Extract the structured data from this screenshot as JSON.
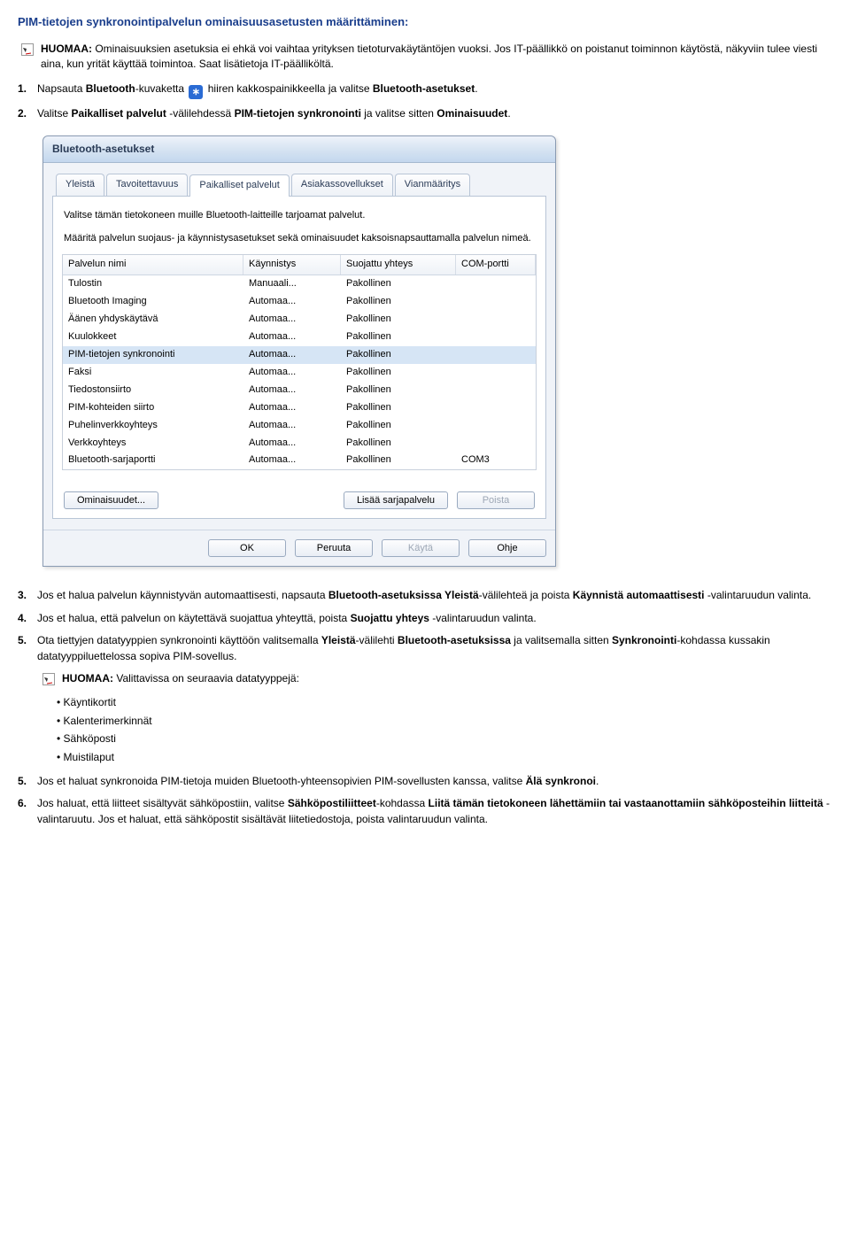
{
  "heading": "PIM-tietojen synkronointipalvelun ominaisuusasetusten määrittäminen:",
  "note1": {
    "label": "HUOMAA:",
    "text": " Ominaisuuksien asetuksia ei ehkä voi vaihtaa yrityksen tietoturvakäytäntöjen vuoksi. Jos IT-päällikkö on poistanut toiminnon käytöstä, näkyviin tulee viesti aina, kun yrität käyttää toimintoa. Saat lisätietoja IT-päälliköltä."
  },
  "step1": {
    "num": "1.",
    "a": "Napsauta ",
    "b1": "Bluetooth",
    "b": "-kuvaketta ",
    "c": " hiiren kakkospainikkeella ja valitse ",
    "b2": "Bluetooth-asetukset",
    "d": "."
  },
  "step2": {
    "num": "2.",
    "a": "Valitse ",
    "b1": "Paikalliset palvelut",
    "b": " -välilehdessä ",
    "b2": "PIM-tietojen synkronointi",
    "c": " ja valitse sitten ",
    "b3": "Ominaisuudet",
    "d": "."
  },
  "dialog": {
    "title": "Bluetooth-asetukset",
    "tabs": [
      "Yleistä",
      "Tavoitettavuus",
      "Paikalliset palvelut",
      "Asiakassovellukset",
      "Vianmääritys"
    ],
    "panel_text1": "Valitse tämän tietokoneen muille Bluetooth-laitteille tarjoamat palvelut.",
    "panel_text2": "Määritä palvelun suojaus- ja käynnistysasetukset sekä ominaisuudet kaksoisnapsauttamalla palvelun nimeä.",
    "headers": [
      "Palvelun nimi",
      "Käynnistys",
      "Suojattu yhteys",
      "COM-portti"
    ],
    "rows": [
      {
        "n": "Tulostin",
        "k": "Manuaali...",
        "s": "Pakollinen",
        "c": ""
      },
      {
        "n": "Bluetooth Imaging",
        "k": "Automaa...",
        "s": "Pakollinen",
        "c": ""
      },
      {
        "n": "Äänen yhdyskäytävä",
        "k": "Automaa...",
        "s": "Pakollinen",
        "c": ""
      },
      {
        "n": "Kuulokkeet",
        "k": "Automaa...",
        "s": "Pakollinen",
        "c": ""
      },
      {
        "n": "PIM-tietojen synkronointi",
        "k": "Automaa...",
        "s": "Pakollinen",
        "c": ""
      },
      {
        "n": "Faksi",
        "k": "Automaa...",
        "s": "Pakollinen",
        "c": ""
      },
      {
        "n": "Tiedostonsiirto",
        "k": "Automaa...",
        "s": "Pakollinen",
        "c": ""
      },
      {
        "n": "PIM-kohteiden siirto",
        "k": "Automaa...",
        "s": "Pakollinen",
        "c": ""
      },
      {
        "n": "Puhelinverkkoyhteys",
        "k": "Automaa...",
        "s": "Pakollinen",
        "c": ""
      },
      {
        "n": "Verkkoyhteys",
        "k": "Automaa...",
        "s": "Pakollinen",
        "c": ""
      },
      {
        "n": "Bluetooth-sarjaportti",
        "k": "Automaa...",
        "s": "Pakollinen",
        "c": "COM3"
      }
    ],
    "btn_props": "Ominaisuudet...",
    "btn_add": "Lisää sarjapalvelu",
    "btn_del": "Poista",
    "btn_ok": "OK",
    "btn_cancel": "Peruuta",
    "btn_apply": "Käytä",
    "btn_help": "Ohje"
  },
  "step3": {
    "num": "3.",
    "a": "Jos et halua palvelun käynnistyvän automaattisesti, napsauta ",
    "b1": "Bluetooth-asetuksissa Yleistä",
    "b": "-välilehteä ja poista ",
    "b2": "Käynnistä automaattisesti",
    "c": " -valintaruudun valinta."
  },
  "step4": {
    "num": "4.",
    "a": "Jos et halua, että palvelun on käytettävä suojattua yhteyttä, poista ",
    "b1": "Suojattu yhteys",
    "b": " -valintaruudun valinta."
  },
  "step5": {
    "num": "5.",
    "a": "Ota tiettyjen datatyyppien synkronointi käyttöön valitsemalla ",
    "b1": "Yleistä",
    "b": "-välilehti ",
    "b2": "Bluetooth-asetuksissa",
    "c": " ja valitsemalla sitten ",
    "b3": "Synkronointi",
    "d": "-kohdassa kussakin datatyyppiluettelossa sopiva PIM-sovellus."
  },
  "note2": {
    "label": "HUOMAA:",
    "text": " Valittavissa on seuraavia datatyyppejä:"
  },
  "bullets": [
    "Käyntikortit",
    "Kalenterimerkinnät",
    "Sähköposti",
    "Muistilaput"
  ],
  "step5b": {
    "num": "5.",
    "a": "Jos et haluat synkronoida PIM-tietoja muiden Bluetooth-yhteensopivien PIM-sovellusten kanssa, valitse ",
    "b1": "Älä synkronoi",
    "b": "."
  },
  "step6": {
    "num": "6.",
    "a": "Jos haluat, että liitteet sisältyvät sähköpostiin, valitse ",
    "b1": "Sähköpostiliitteet",
    "b": "-kohdassa ",
    "b2": "Liitä tämän tietokoneen lähettämiin tai vastaanottamiin sähköposteihin liitteitä",
    "c": " -valintaruutu. Jos et haluat, että sähköpostit sisältävät liitetiedostoja, poista valintaruudun valinta."
  }
}
